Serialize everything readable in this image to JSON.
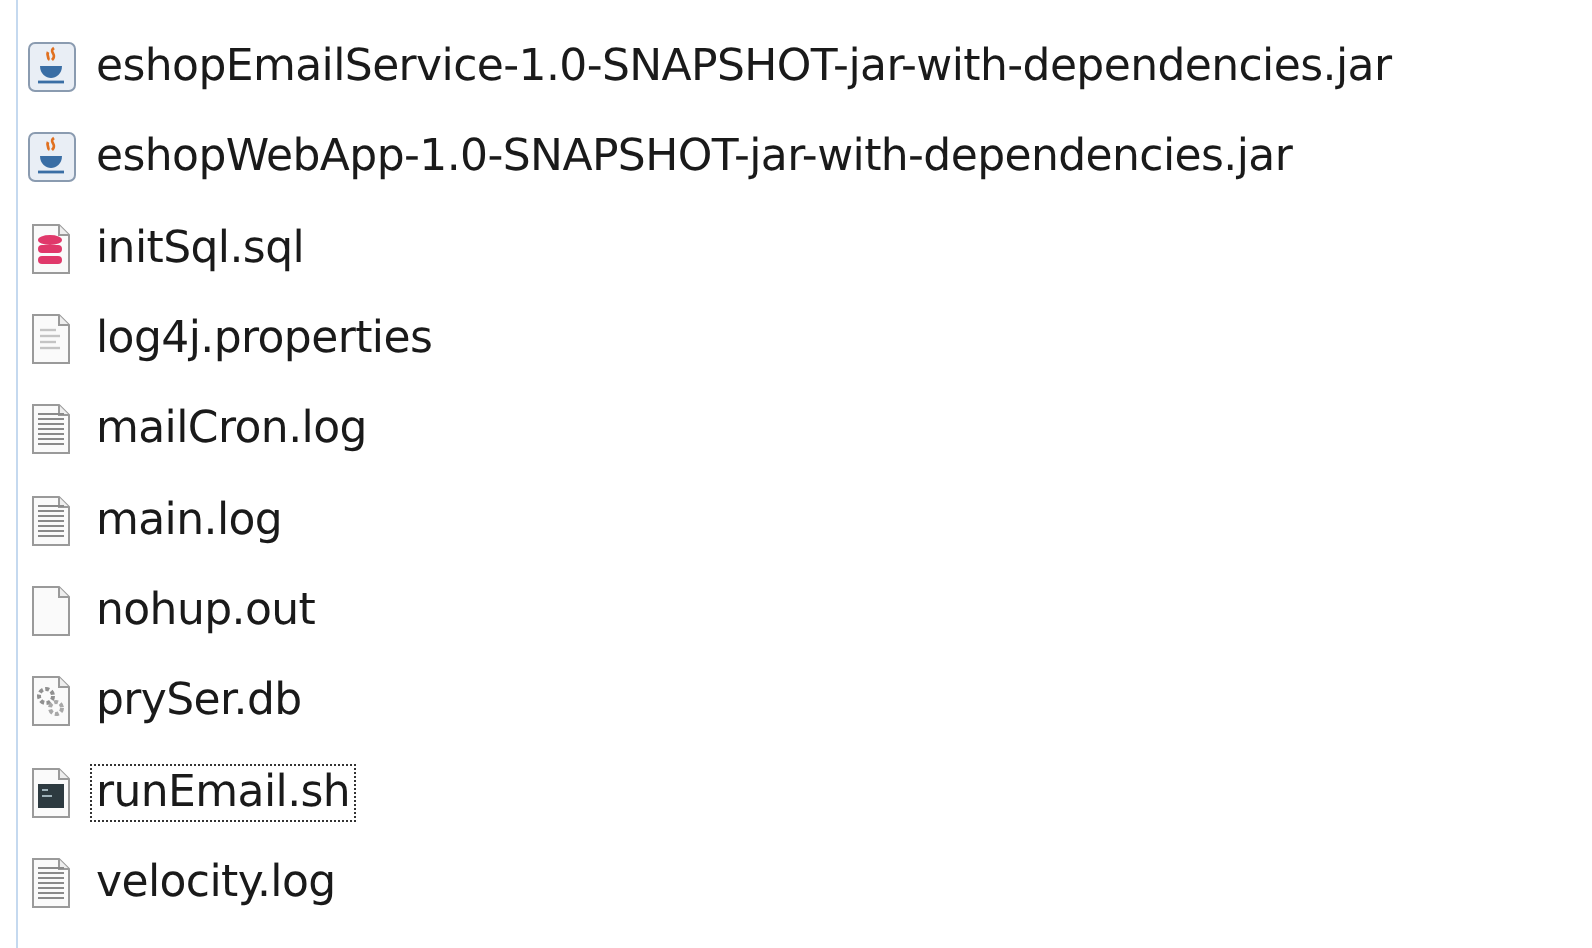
{
  "files": [
    {
      "name": "eshopEmailService-1.0-SNAPSHOT-jar-with-dependencies.jar",
      "kind": "jar",
      "focused": false
    },
    {
      "name": "eshopWebApp-1.0-SNAPSHOT-jar-with-dependencies.jar",
      "kind": "jar",
      "focused": false
    },
    {
      "name": "initSql.sql",
      "kind": "sql",
      "focused": false
    },
    {
      "name": "log4j.properties",
      "kind": "properties",
      "focused": false
    },
    {
      "name": "mailCron.log",
      "kind": "log",
      "focused": false
    },
    {
      "name": "main.log",
      "kind": "log",
      "focused": false
    },
    {
      "name": "nohup.out",
      "kind": "blank",
      "focused": false
    },
    {
      "name": "prySer.db",
      "kind": "gear",
      "focused": false
    },
    {
      "name": "runEmail.sh",
      "kind": "shell",
      "focused": true
    },
    {
      "name": "velocity.log",
      "kind": "log",
      "focused": false
    }
  ]
}
